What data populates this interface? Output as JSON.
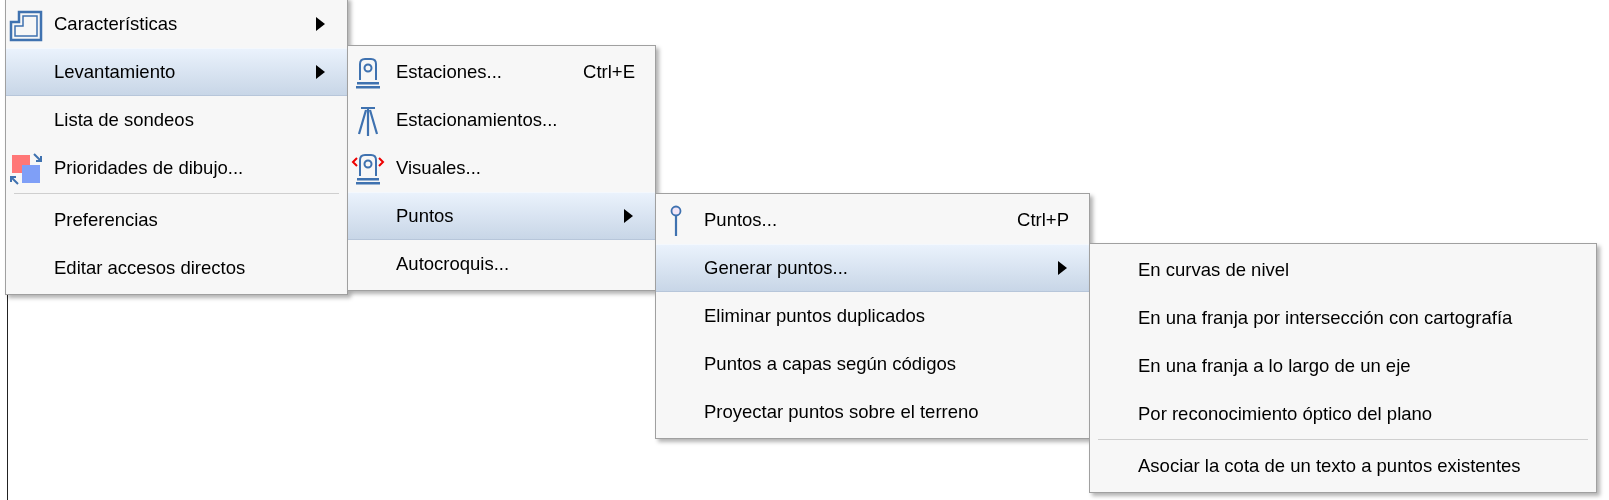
{
  "menus": [
    {
      "items": [
        {
          "kind": "item",
          "label": "Características",
          "submenu": true,
          "selected": false
        },
        {
          "kind": "item",
          "label": "Levantamiento",
          "submenu": true,
          "selected": true
        },
        {
          "kind": "item",
          "label": "Lista de sondeos",
          "submenu": false,
          "selected": false
        },
        {
          "kind": "item",
          "label": "Prioridades de dibujo...",
          "submenu": false,
          "selected": false
        },
        {
          "kind": "separator"
        },
        {
          "kind": "item",
          "label": "Preferencias",
          "submenu": false,
          "selected": false
        },
        {
          "kind": "item",
          "label": "Editar accesos directos",
          "submenu": false,
          "selected": false
        }
      ]
    },
    {
      "items": [
        {
          "kind": "item",
          "label": "Estaciones...",
          "shortcut": "Ctrl+E",
          "submenu": false,
          "selected": false
        },
        {
          "kind": "item",
          "label": "Estacionamientos...",
          "submenu": false,
          "selected": false
        },
        {
          "kind": "item",
          "label": "Visuales...",
          "submenu": false,
          "selected": false
        },
        {
          "kind": "item",
          "label": "Puntos",
          "submenu": true,
          "selected": true
        },
        {
          "kind": "item",
          "label": "Autocroquis...",
          "submenu": false,
          "selected": false
        }
      ]
    },
    {
      "items": [
        {
          "kind": "item",
          "label": "Puntos...",
          "shortcut": "Ctrl+P",
          "submenu": false,
          "selected": false
        },
        {
          "kind": "item",
          "label": "Generar puntos...",
          "submenu": true,
          "selected": true
        },
        {
          "kind": "item",
          "label": "Eliminar puntos duplicados",
          "submenu": false,
          "selected": false
        },
        {
          "kind": "item",
          "label": "Puntos a capas según códigos",
          "submenu": false,
          "selected": false
        },
        {
          "kind": "item",
          "label": "Proyectar puntos sobre el terreno",
          "submenu": false,
          "selected": false
        }
      ]
    },
    {
      "items": [
        {
          "kind": "item",
          "label": "En curvas de nivel",
          "submenu": false,
          "selected": false
        },
        {
          "kind": "item",
          "label": "En una franja por intersección con cartografía",
          "submenu": false,
          "selected": false
        },
        {
          "kind": "item",
          "label": "En una franja a lo largo de un eje",
          "submenu": false,
          "selected": false
        },
        {
          "kind": "item",
          "label": "Por reconocimiento óptico del plano",
          "submenu": false,
          "selected": false
        },
        {
          "kind": "separator"
        },
        {
          "kind": "item",
          "label": "Asociar la cota de un texto a puntos existentes",
          "submenu": false,
          "selected": false
        }
      ]
    }
  ]
}
